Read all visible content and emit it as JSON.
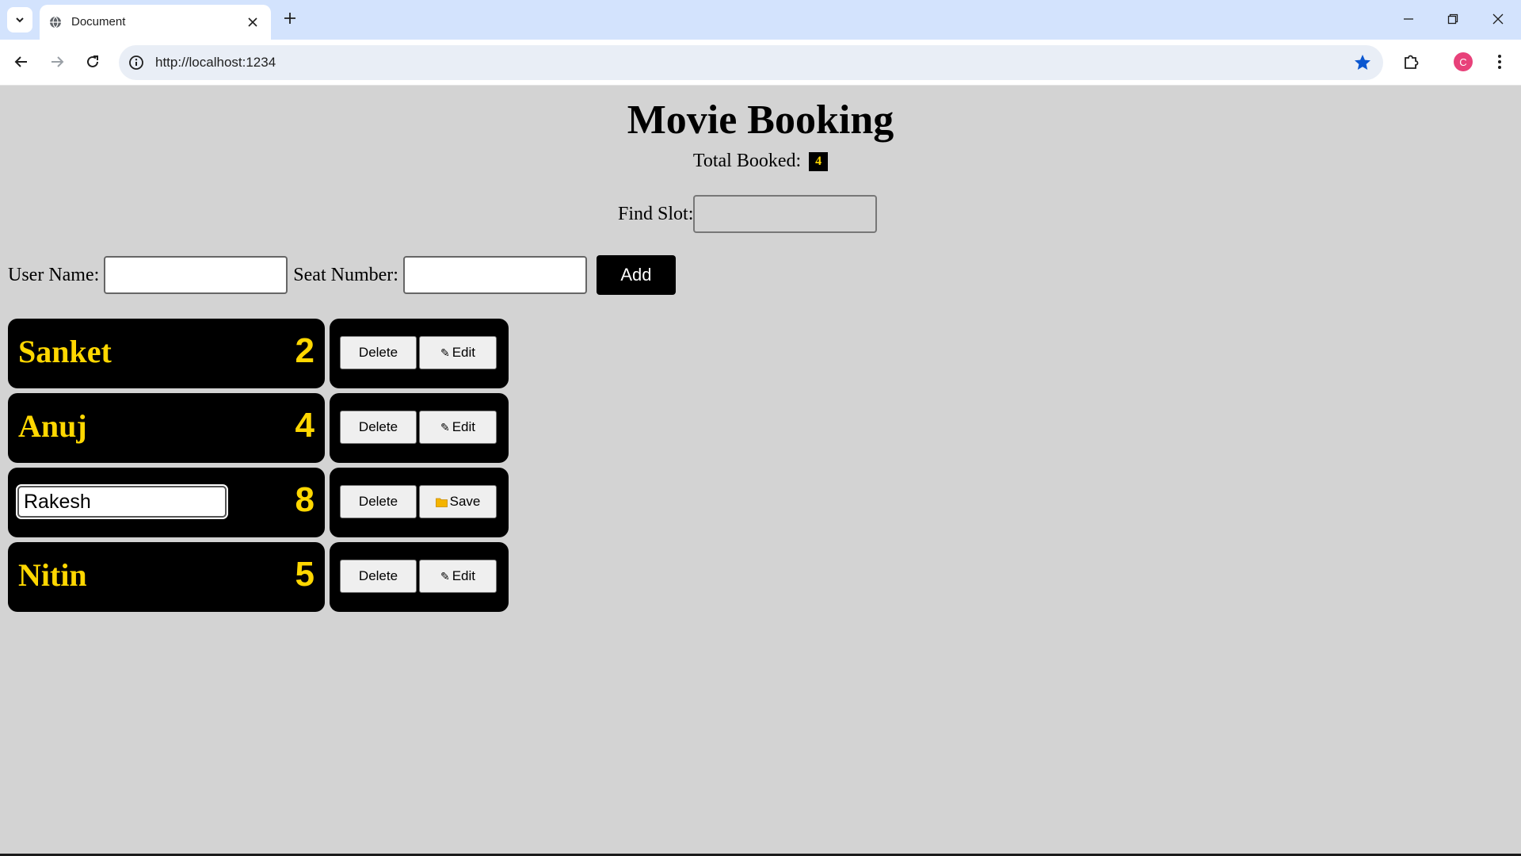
{
  "browser": {
    "tab_title": "Document",
    "url": "http://localhost:1234",
    "profile_initial": "C"
  },
  "page": {
    "title": "Movie Booking",
    "total_label": "Total Booked:",
    "total_count": "4",
    "find_label": "Find Slot:",
    "find_value": "",
    "username_label": "User Name:",
    "seat_label": "Seat Number:",
    "add_label": "Add"
  },
  "bookings": [
    {
      "name": "Sanket",
      "seat": "2",
      "editing": false,
      "delete_label": "Delete",
      "action_label": "Edit",
      "action_icon": "pencil-icon"
    },
    {
      "name": "Anuj",
      "seat": "4",
      "editing": false,
      "delete_label": "Delete",
      "action_label": "Edit",
      "action_icon": "pencil-icon"
    },
    {
      "name": "Rakesh",
      "seat": "8",
      "editing": true,
      "delete_label": "Delete",
      "action_label": "Save",
      "action_icon": "folder-icon"
    },
    {
      "name": "Nitin",
      "seat": "5",
      "editing": false,
      "delete_label": "Delete",
      "action_label": "Edit",
      "action_icon": "pencil-icon"
    }
  ],
  "colors": {
    "accent_text": "#ffd700",
    "card_bg": "#000000",
    "page_bg": "#d3d3d3"
  }
}
